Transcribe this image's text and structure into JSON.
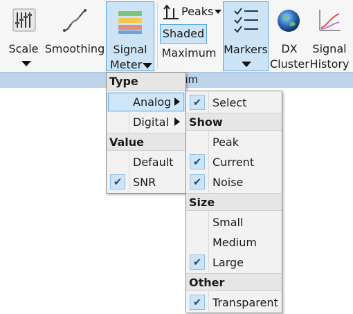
{
  "ribbon": {
    "buttons": {
      "scale": "Scale",
      "smoothing": "Smoothing",
      "signal_meter_line1": "Signal",
      "signal_meter_line2": "Meter",
      "peaks": "Peaks",
      "shaded": "Shaded",
      "maximum": "Maximum",
      "markers": "Markers",
      "dx_cluster_line1": "DX",
      "dx_cluster_line2": "Cluster",
      "signal_history_line1": "Signal",
      "signal_history_line2": "History"
    },
    "group_label": "um"
  },
  "signal_meter_menu": {
    "type_header": "Type",
    "analog": "Analog",
    "digital": "Digital",
    "value_header": "Value",
    "default": "Default",
    "snr": "SNR",
    "snr_checked": true
  },
  "analog_submenu": {
    "select": "Select",
    "select_checked": true,
    "show_header": "Show",
    "peak": "Peak",
    "current": "Current",
    "current_checked": true,
    "noise": "Noise",
    "noise_checked": true,
    "size_header": "Size",
    "small": "Small",
    "medium": "Medium",
    "large": "Large",
    "large_checked": true,
    "other_header": "Other",
    "transparent": "Transparent",
    "transparent_checked": true
  },
  "icons": {
    "scale": "scale-icon",
    "smoothing": "smoothing-icon",
    "signal_meter": "signal-meter-icon",
    "peaks": "peaks-icon",
    "markers": "markers-list-icon",
    "dx_cluster": "globe-icon",
    "signal_history": "history-chart-icon",
    "check": "check-icon"
  },
  "colors": {
    "highlight": "#cde4f7",
    "highlight_border": "#5aa6de",
    "group_bar": "#bcd3ea"
  }
}
